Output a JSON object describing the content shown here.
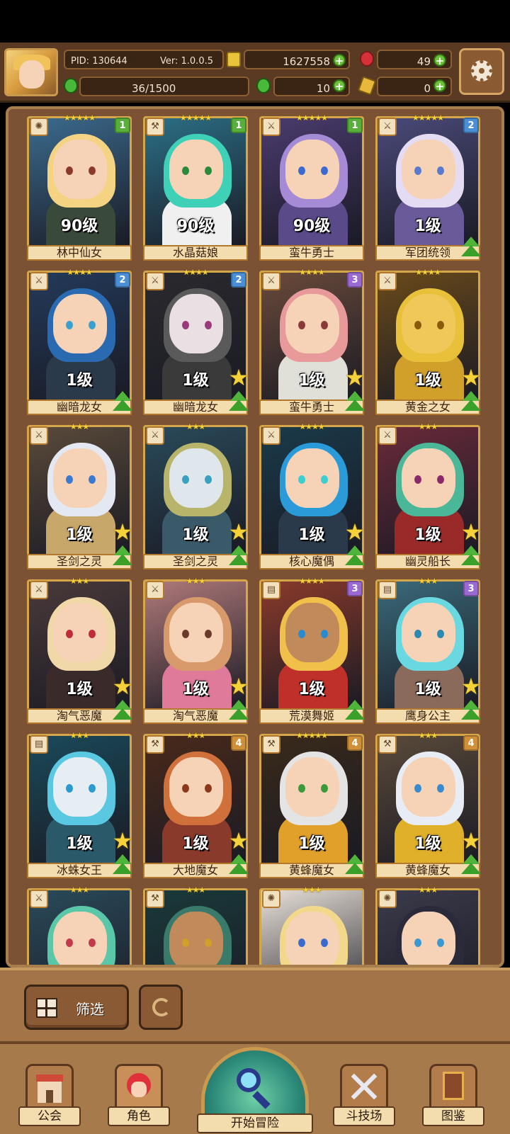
{
  "header": {
    "pid": "PID: 130644",
    "version": "Ver: 1.0.0.5",
    "exp": "36/1500",
    "gold": "1627558",
    "gems": "49",
    "clover": "10",
    "keys": "0"
  },
  "colors": {
    "rank1": "#58b03a",
    "rank2": "#4a8fd6",
    "rank3": "#9a6ad2",
    "rank4": "#d0903a"
  },
  "cards": [
    {
      "name": "林中仙女",
      "level": "90级",
      "stars": "★★★★★",
      "rank": "1",
      "icon": "sun-icon",
      "hair": "#f4d382",
      "bg": "#3b6b8e",
      "skin": "#f6d3b7",
      "body": "#3a4a3a",
      "eye": "#8b3a2a",
      "big_star": false,
      "upgrade": false
    },
    {
      "name": "水晶菇娘",
      "level": "90级",
      "stars": "★★★★★",
      "rank": "1",
      "icon": "wrench-icon",
      "hair": "#3fd1b8",
      "bg": "#2b6f86",
      "skin": "#f6d3b7",
      "body": "#f0f0f0",
      "eye": "#2a8a3a",
      "big_star": false,
      "upgrade": false
    },
    {
      "name": "蛮牛勇士",
      "level": "90级",
      "stars": "★★★★★",
      "rank": "1",
      "icon": "sword-icon",
      "hair": "#a58ad6",
      "bg": "#4a3b6e",
      "skin": "#f6d3b7",
      "body": "#5a4a8a",
      "eye": "#3a6ad0",
      "big_star": false,
      "upgrade": false
    },
    {
      "name": "军团统领",
      "level": "1级",
      "stars": "★★★★★",
      "rank": "2",
      "icon": "sword-icon",
      "hair": "#e4dcf2",
      "bg": "#4a4a7a",
      "skin": "#f6d3b7",
      "body": "#6a5a9a",
      "eye": "#5a7ad0",
      "big_star": false,
      "upgrade": true
    },
    {
      "name": "幽暗龙女",
      "level": "1级",
      "stars": "★★★★",
      "rank": "2",
      "icon": "sword-icon",
      "hair": "#2a6ab0",
      "bg": "#233a5a",
      "skin": "#f6d3b7",
      "body": "#2a3a4a",
      "eye": "#3aa0d0",
      "big_star": false,
      "upgrade": true
    },
    {
      "name": "幽暗龙女",
      "level": "1级",
      "stars": "★★★★",
      "rank": "2",
      "icon": "sword-icon",
      "hair": "#5a5a5a",
      "bg": "#2a2a2e",
      "skin": "#eae0e4",
      "body": "#3a3a3a",
      "eye": "#9a3a7a",
      "big_star": true,
      "upgrade": true
    },
    {
      "name": "蛮牛勇士",
      "level": "1级",
      "stars": "★★★★",
      "rank": "3",
      "icon": "sword-icon",
      "hair": "#e89a9a",
      "bg": "#6a4a3a",
      "skin": "#f6d3b7",
      "body": "#e0e0d8",
      "eye": "#8a3a3a",
      "big_star": true,
      "upgrade": true
    },
    {
      "name": "黄金之女",
      "level": "1级",
      "stars": "★★★★",
      "rank": "",
      "icon": "sword-icon",
      "hair": "#e8c03a",
      "bg": "#6a4a1a",
      "skin": "#f0c85a",
      "body": "#d0a02a",
      "eye": "#8a5a0a",
      "big_star": true,
      "upgrade": true
    },
    {
      "name": "圣剑之灵",
      "level": "1级",
      "stars": "★★★",
      "rank": "",
      "icon": "sword-icon",
      "hair": "#e4e8f2",
      "bg": "#5a4a3a",
      "skin": "#f6d3b7",
      "body": "#c8a86a",
      "eye": "#3a7ad0",
      "big_star": true,
      "upgrade": true
    },
    {
      "name": "圣剑之灵",
      "level": "1级",
      "stars": "★★★",
      "rank": "",
      "icon": "sword-icon",
      "hair": "#b8b46a",
      "bg": "#2a4a5a",
      "skin": "#dfe6ec",
      "body": "#3a5a6a",
      "eye": "#3aa0c0",
      "big_star": true,
      "upgrade": true
    },
    {
      "name": "核心魔偶",
      "level": "1级",
      "stars": "★★★★",
      "rank": "",
      "icon": "sword-icon",
      "hair": "#2a9ad8",
      "bg": "#1a3a4a",
      "skin": "#f6d3b7",
      "body": "#2a3a4a",
      "eye": "#3ad0d0",
      "big_star": true,
      "upgrade": true
    },
    {
      "name": "幽灵船长",
      "level": "1级",
      "stars": "★★★",
      "rank": "",
      "icon": "sword-icon",
      "hair": "#4ab898",
      "bg": "#6a2a3a",
      "skin": "#f6d3b7",
      "body": "#9a2a2a",
      "eye": "#8a2a6a",
      "big_star": true,
      "upgrade": true
    },
    {
      "name": "淘气恶魔",
      "level": "1级",
      "stars": "★★★",
      "rank": "",
      "icon": "sword-icon",
      "hair": "#f0d8a8",
      "bg": "#4a3a3a",
      "skin": "#f6d3b7",
      "body": "#3a2a2a",
      "eye": "#c02a3a",
      "big_star": true,
      "upgrade": true
    },
    {
      "name": "淘气恶魔",
      "level": "1级",
      "stars": "★★★",
      "rank": "",
      "icon": "sword-icon",
      "hair": "#d89a6a",
      "bg": "#b07a7a",
      "skin": "#f6d3b7",
      "body": "#e07a9a",
      "eye": "#6a3a2a",
      "big_star": true,
      "upgrade": true
    },
    {
      "name": "荒漠舞姬",
      "level": "1级",
      "stars": "★★★★",
      "rank": "3",
      "icon": "scroll-icon",
      "hair": "#f0c04a",
      "bg": "#8a3a2a",
      "skin": "#c08a5a",
      "body": "#c0302a",
      "eye": "#2a8ad0",
      "big_star": false,
      "upgrade": true
    },
    {
      "name": "鹰身公主",
      "level": "1级",
      "stars": "★★★",
      "rank": "3",
      "icon": "scroll-icon",
      "hair": "#6ad8e0",
      "bg": "#3a6a7a",
      "skin": "#f6d3b7",
      "body": "#8a6a5a",
      "eye": "#2a8ab0",
      "big_star": true,
      "upgrade": true
    },
    {
      "name": "冰蛛女王",
      "level": "1级",
      "stars": "★★★",
      "rank": "",
      "icon": "scroll-icon",
      "hair": "#5ac8e0",
      "bg": "#1a4a5a",
      "skin": "#e6eef4",
      "body": "#2a5a6a",
      "eye": "#2a9ad0",
      "big_star": true,
      "upgrade": true
    },
    {
      "name": "大地魔女",
      "level": "1级",
      "stars": "★★★",
      "rank": "4",
      "icon": "wrench-icon",
      "hair": "#d0703a",
      "bg": "#4a2a1a",
      "skin": "#f6d3b7",
      "body": "#8a3a2a",
      "eye": "#8a3a1a",
      "big_star": true,
      "upgrade": true
    },
    {
      "name": "黄蜂魔女",
      "level": "1级",
      "stars": "★★★★★",
      "rank": "4",
      "icon": "wrench-icon",
      "hair": "#e4e4e4",
      "bg": "#3a2a1a",
      "skin": "#f6d3b7",
      "body": "#e0a02a",
      "eye": "#3a9a3a",
      "big_star": false,
      "upgrade": true
    },
    {
      "name": "黄蜂魔女",
      "level": "1级",
      "stars": "★★★",
      "rank": "4",
      "icon": "wrench-icon",
      "hair": "#e8ecf4",
      "bg": "#5a4a3a",
      "skin": "#f6d3b7",
      "body": "#e0b02a",
      "eye": "#3a8ad0",
      "big_star": true,
      "upgrade": true
    },
    {
      "name": "",
      "level": "",
      "stars": "★★★",
      "rank": "",
      "icon": "sword-icon",
      "hair": "#5ac8a8",
      "bg": "#2a4a5a",
      "skin": "#f6d3b7",
      "body": "#2a3a4a",
      "eye": "#c03a4a",
      "big_star": false,
      "upgrade": false
    },
    {
      "name": "",
      "level": "",
      "stars": "★★★",
      "rank": "",
      "icon": "wrench-icon",
      "hair": "#3a7a6a",
      "bg": "#1a3a3a",
      "skin": "#c08a5a",
      "body": "#2a3a3a",
      "eye": "#d0a02a",
      "big_star": false,
      "upgrade": false
    },
    {
      "name": "",
      "level": "",
      "stars": "★★★",
      "rank": "",
      "icon": "sun-icon",
      "hair": "#f2d88a",
      "bg": "#e8e0d8",
      "skin": "#f6d3b7",
      "body": "#f0e6d8",
      "eye": "#3a6ad0",
      "big_star": false,
      "upgrade": false
    },
    {
      "name": "",
      "level": "",
      "stars": "★★★",
      "rank": "",
      "icon": "sun-icon",
      "hair": "#2a2a3a",
      "bg": "#3a3a4a",
      "skin": "#f6d3b7",
      "body": "#2a2a3a",
      "eye": "#3a9ad0",
      "big_star": false,
      "upgrade": false
    }
  ],
  "toolbar": {
    "filter_label": "筛选"
  },
  "nav": {
    "guild": "公会",
    "character": "角色",
    "adventure": "开始冒险",
    "arena": "斗技场",
    "codex": "图鉴"
  }
}
